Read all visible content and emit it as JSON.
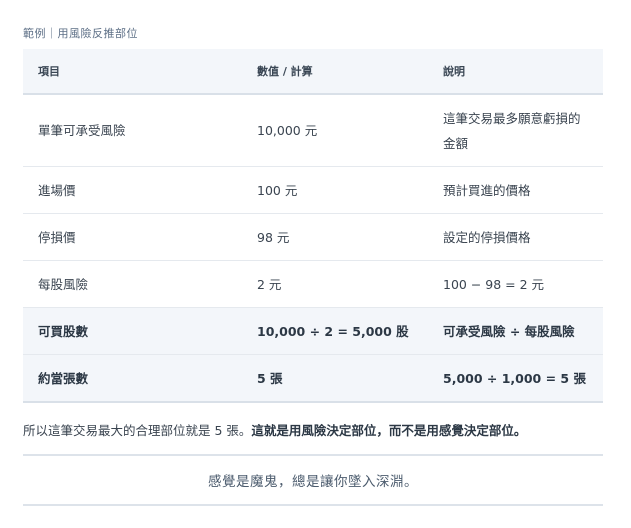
{
  "caption": "範例｜用風險反推部位",
  "table": {
    "headers": [
      "項目",
      "數值 / 計算",
      "說明"
    ],
    "rows": [
      {
        "item": "單筆可承受風險",
        "value": "10,000 元",
        "note": "這筆交易最多願意虧損的金額"
      },
      {
        "item": "進場價",
        "value": "100 元",
        "note": "預計買進的價格"
      },
      {
        "item": "停損價",
        "value": "98 元",
        "note": "設定的停損價格"
      },
      {
        "item": "每股風險",
        "value": "2 元",
        "note": "100 − 98 = 2 元"
      },
      {
        "item": "可買股數",
        "value": "10,000 ÷ 2 = 5,000 股",
        "note": "可承受風險 ÷ 每股風險"
      },
      {
        "item": "約當張數",
        "value": "5 張",
        "note": "5,000 ÷ 1,000 = 5 張"
      }
    ]
  },
  "summary": {
    "plain": "所以這筆交易最大的合理部位就是 5 張。",
    "bold": "這就是用風險決定部位，而不是用感覺決定部位。"
  },
  "quote": "感覺是魔鬼，總是讓你墜入深淵。"
}
